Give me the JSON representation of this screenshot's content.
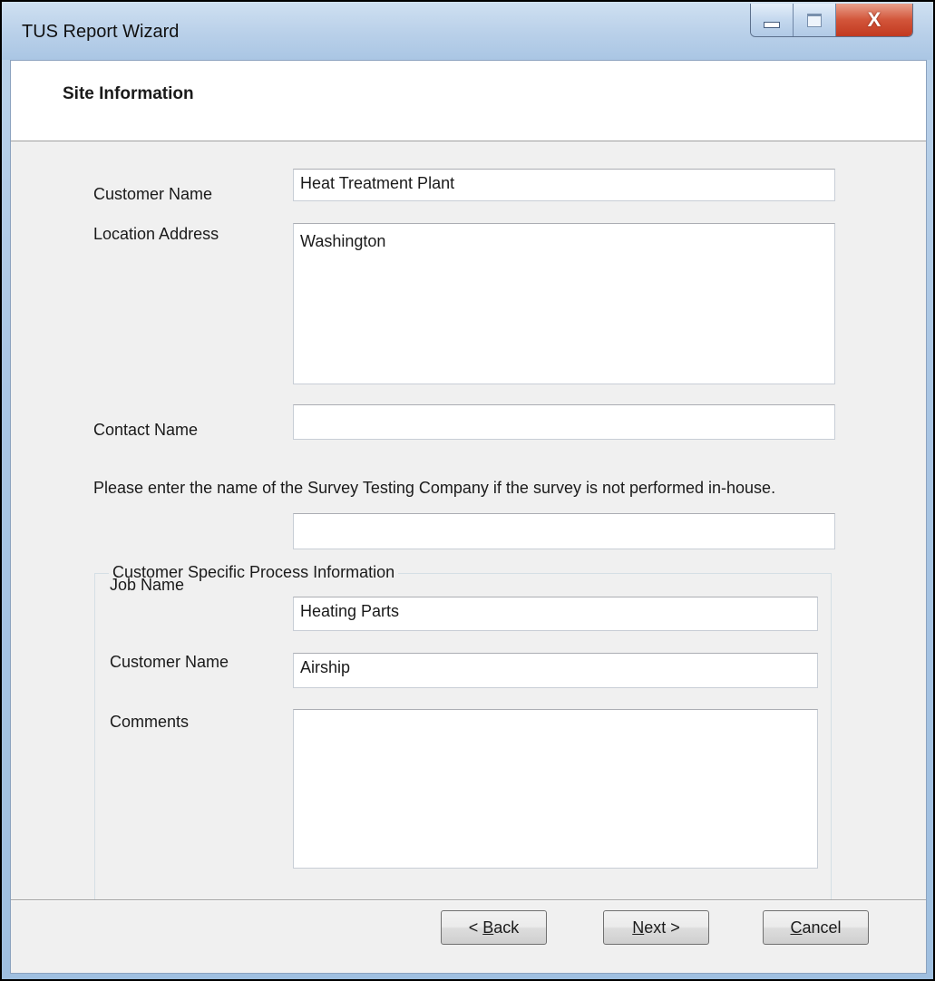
{
  "window": {
    "title": "TUS Report Wizard",
    "close_glyph": "X"
  },
  "page": {
    "title": "Site Information"
  },
  "form": {
    "customer_name_label": "Customer Name",
    "customer_name_value": "Heat Treatment Plant",
    "location_address_label": "Location Address",
    "location_address_value": "Washington",
    "contact_name_label": "Contact Name",
    "contact_name_value": "",
    "survey_company_prompt": "Please enter the name of the Survey Testing Company if the survey is not performed in-house.",
    "survey_company_value": ""
  },
  "process_group": {
    "legend": "Customer Specific Process Information",
    "job_name_label": "Job Name",
    "job_name_value": "Heating Parts",
    "customer_name_label": "Customer Name",
    "customer_name_value": "Airship",
    "comments_label": "Comments",
    "comments_value": ""
  },
  "buttons": {
    "back": {
      "prefix": "< ",
      "mnemonic": "B",
      "rest": "ack"
    },
    "next": {
      "prefix": "",
      "mnemonic": "N",
      "rest": "ext >"
    },
    "cancel": {
      "prefix": "",
      "mnemonic": "C",
      "rest": "ancel"
    }
  }
}
